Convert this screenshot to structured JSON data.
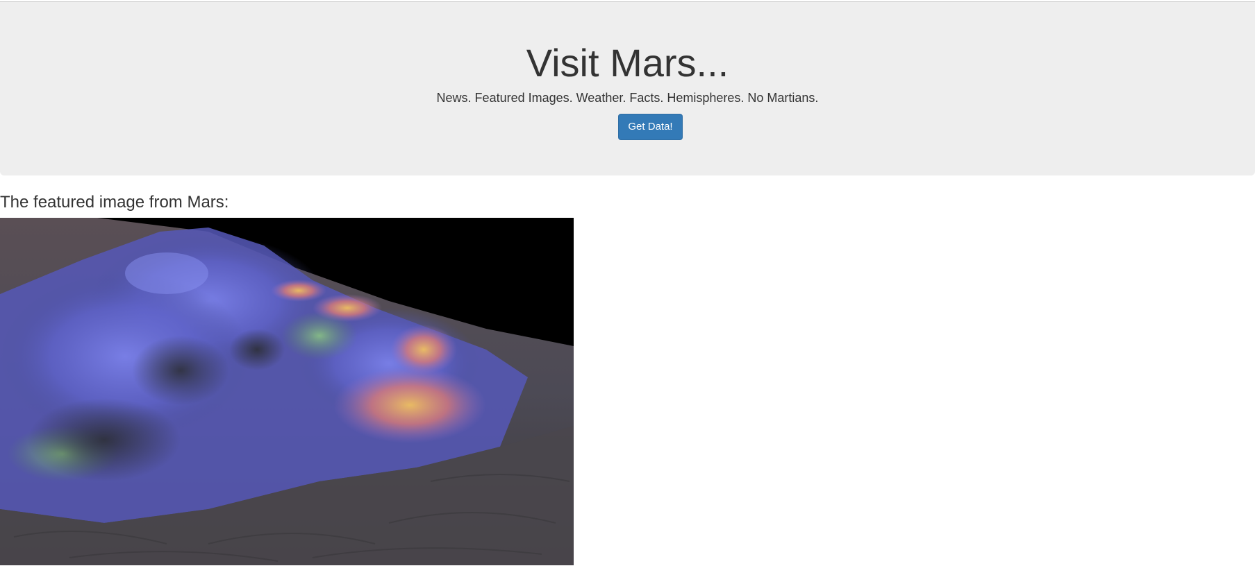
{
  "jumbotron": {
    "title": "Visit Mars...",
    "tagline": "News. Featured Images. Weather. Facts. Hemispheres. No Martians.",
    "button_label": "Get Data!"
  },
  "featured": {
    "heading": "The featured image from Mars:",
    "image_alt": "featured-mars-image"
  },
  "colors": {
    "jumbotron_bg": "#eeeeee",
    "button_bg": "#337ab7",
    "text": "#333333"
  }
}
